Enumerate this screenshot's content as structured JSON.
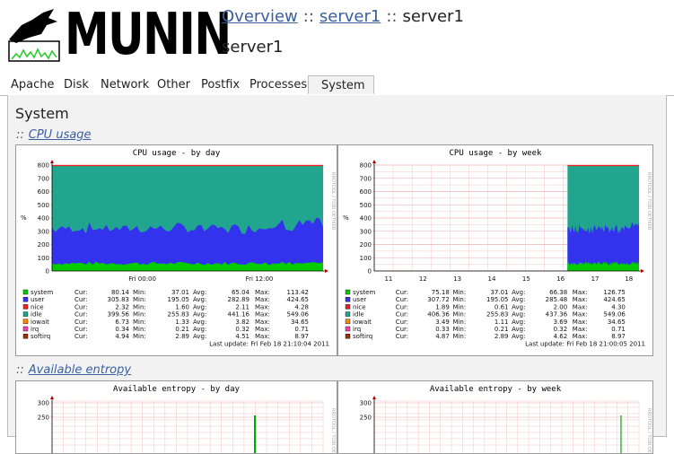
{
  "logo": {
    "text": "MUNIN"
  },
  "breadcrumb": {
    "overview": "Overview",
    "server": "server1",
    "sep": "::",
    "current": "server1"
  },
  "host_title": "server1",
  "tabs": [
    "Apache",
    "Disk",
    "Network",
    "Other",
    "Postfix",
    "Processes",
    "System"
  ],
  "active_tab": "System",
  "panel_title": "System",
  "sections": [
    {
      "prefix": "::",
      "link": "CPU usage"
    },
    {
      "prefix": "::",
      "link": "Available entropy"
    }
  ],
  "colors": {
    "system": "#00cc00",
    "user": "#3333ee",
    "nice": "#ee2222",
    "idle": "#22a58f",
    "iowait": "#ff8800",
    "irq": "#ee44aa",
    "softirq": "#993300",
    "accent": "#3a5f9f"
  },
  "rrd_watermark": "RRDTOOL / TOBI OETIKER",
  "cpu_day": {
    "title": "CPU usage - by day",
    "ylabel": "%",
    "yticks": [
      "800",
      "700",
      "600",
      "500",
      "400",
      "300",
      "200",
      "100",
      "0"
    ],
    "xticks": [
      "Fri 00:00",
      "Fri 12:00"
    ],
    "updated": "Last update: Fri Feb 18 21:10:04 2011",
    "legend": [
      {
        "name": "system",
        "cur": "80.14",
        "min": "37.01",
        "avg": "65.04",
        "max": "113.42"
      },
      {
        "name": "user",
        "cur": "305.83",
        "min": "195.05",
        "avg": "282.89",
        "max": "424.65"
      },
      {
        "name": "nice",
        "cur": "2.32",
        "min": "1.60",
        "avg": "2.11",
        "max": "4.28"
      },
      {
        "name": "idle",
        "cur": "399.56",
        "min": "255.83",
        "avg": "441.16",
        "max": "549.06"
      },
      {
        "name": "iowait",
        "cur": "6.73",
        "min": "1.33",
        "avg": "3.82",
        "max": "34.65"
      },
      {
        "name": "irq",
        "cur": "0.34",
        "min": "0.21",
        "avg": "0.32",
        "max": "0.71"
      },
      {
        "name": "softirq",
        "cur": "4.94",
        "min": "2.89",
        "avg": "4.51",
        "max": "8.97"
      }
    ]
  },
  "cpu_week": {
    "title": "CPU usage - by week",
    "ylabel": "%",
    "yticks": [
      "800",
      "700",
      "600",
      "500",
      "400",
      "300",
      "200",
      "100",
      "0"
    ],
    "xticks": [
      "11",
      "12",
      "13",
      "14",
      "15",
      "16",
      "17",
      "18"
    ],
    "updated": "Last update: Fri Feb 18 21:00:05 2011",
    "legend": [
      {
        "name": "system",
        "cur": "75.18",
        "min": "37.01",
        "avg": "66.38",
        "max": "126.75"
      },
      {
        "name": "user",
        "cur": "307.72",
        "min": "195.05",
        "avg": "285.48",
        "max": "424.65"
      },
      {
        "name": "nice",
        "cur": "1.89",
        "min": "0.61",
        "avg": "2.00",
        "max": "4.30"
      },
      {
        "name": "idle",
        "cur": "406.36",
        "min": "255.83",
        "avg": "437.36",
        "max": "549.06"
      },
      {
        "name": "iowait",
        "cur": "3.49",
        "min": "1.11",
        "avg": "3.69",
        "max": "34.65"
      },
      {
        "name": "irq",
        "cur": "0.33",
        "min": "0.21",
        "avg": "0.32",
        "max": "0.71"
      },
      {
        "name": "softirq",
        "cur": "4.87",
        "min": "2.89",
        "avg": "4.62",
        "max": "8.97"
      }
    ]
  },
  "col_labels": {
    "cur": "Cur:",
    "min": "Min:",
    "avg": "Avg:",
    "max": "Max:"
  },
  "entropy_day": {
    "title": "Available entropy - by day",
    "yticks": [
      "300",
      "250"
    ]
  },
  "entropy_week": {
    "title": "Available entropy - by week",
    "yticks": [
      "300",
      "250"
    ]
  }
}
